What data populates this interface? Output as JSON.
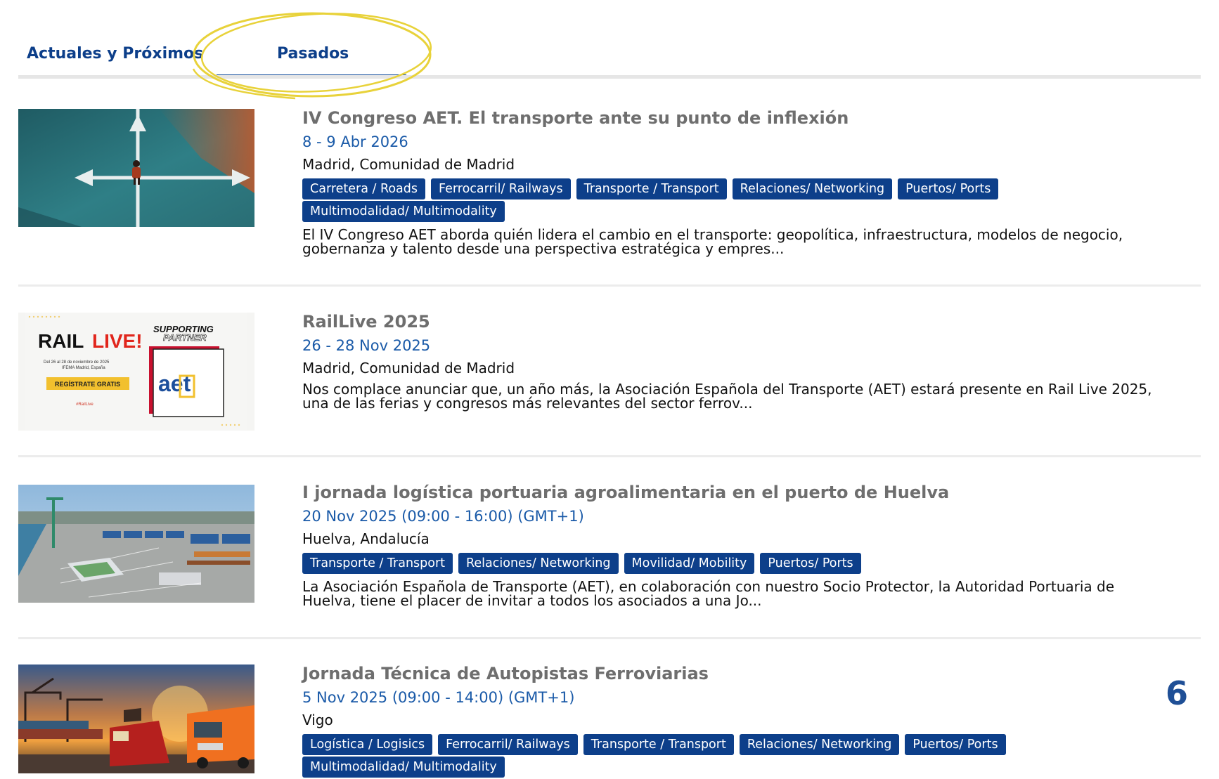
{
  "tabs": {
    "current": "Actuales y Próximos",
    "past": "Pasados",
    "active": "Pasados"
  },
  "accent_color": "#0d3f8a",
  "highlight_color": "#e8d23a",
  "events": [
    {
      "title": "IV Congreso AET. El transporte ante su punto de inflexión",
      "date": "8 - 9 Abr 2026",
      "location": "Madrid, Comunidad de Madrid",
      "tags": [
        "Carretera / Roads",
        "Ferrocarril/ Railways",
        "Transporte / Transport",
        "Relaciones/ Networking",
        "Puertos/ Ports",
        "Multimodalidad/ Multimodality"
      ],
      "description": [
        "El IV Congreso AET aborda quién lidera el cambio en el transporte: geopolítica, infraestructura, modelos de negocio,",
        "gobernanza y talento desde una perspectiva estratégica y empres..."
      ],
      "image": "crossroads-person-aerial"
    },
    {
      "title": "RailLive 2025",
      "date": "26 - 28 Nov 2025",
      "location": "Madrid, Comunidad de Madrid",
      "tags": [],
      "description": [
        "Nos complace anunciar que, un año más, la Asociación Española del Transporte (AET) estará presente en Rail Live 2025,",
        "una de las ferias y congresos más relevantes del sector ferrov..."
      ],
      "image": "raillive-banner",
      "banner": {
        "logo_rail": "RAIL",
        "logo_live": "LIVE!",
        "dates": "Del 26 al 28 de noviembre de 2025",
        "venue": "IFEMA Madrid, España",
        "cta": "REGÍSTRATE GRATIS",
        "hashtag": "#RailLive",
        "supporting": "SUPPORTING",
        "partner": "PARTNER",
        "aet_logo": "aet"
      }
    },
    {
      "title": "I jornada logística portuaria agroalimentaria en el puerto de Huelva",
      "date": "20 Nov 2025 (09:00 - 16:00) (GMT+1)",
      "location": "Huelva, Andalucía",
      "tags": [
        "Transporte / Transport",
        "Relaciones/ Networking",
        "Movilidad/ Mobility",
        "Puertos/ Ports"
      ],
      "description": [
        "La Asociación Española de Transporte (AET), en colaboración con nuestro Socio Protector, la Autoridad Portuaria de",
        "Huelva, tiene el placer de invitar a todos los asociados a una Jo..."
      ],
      "image": "port-aerial"
    },
    {
      "title": "Jornada Técnica de Autopistas Ferroviarias",
      "date": "5 Nov 2025 (09:00 - 14:00) (GMT+1)",
      "location": "Vigo",
      "tags": [
        "Logística / Logisics",
        "Ferrocarril/ Railways",
        "Transporte / Transport",
        "Relaciones/ Networking",
        "Puertos/ Ports",
        "Multimodalidad/ Multimodality"
      ],
      "description": [],
      "image": "train-truck-port-sunset"
    }
  ],
  "page_number": "6"
}
